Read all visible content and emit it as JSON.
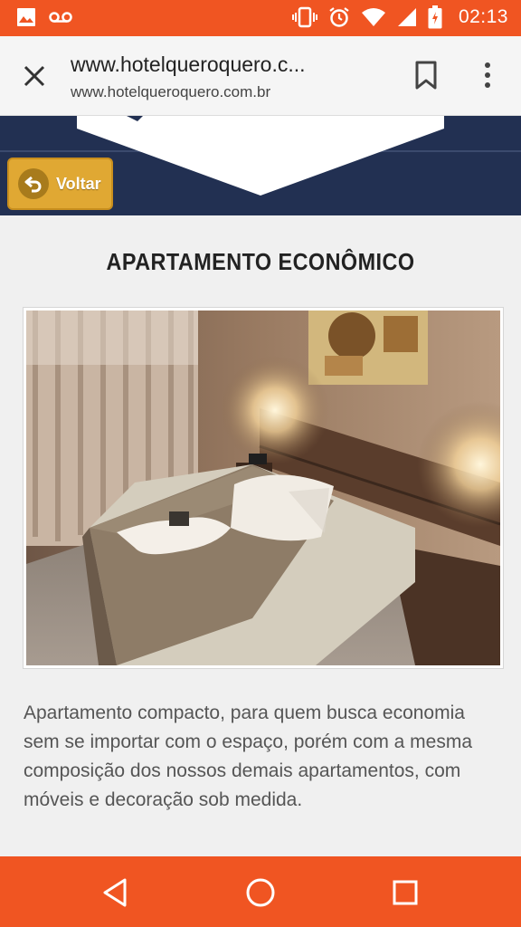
{
  "status_bar": {
    "time": "02:13",
    "left_icons": [
      "image-icon",
      "voicemail-icon"
    ],
    "right_icons": [
      "vibrate-icon",
      "alarm-icon",
      "wifi-icon",
      "signal-icon",
      "battery-icon"
    ]
  },
  "browser": {
    "page_title": "www.hotelqueroquero.c...",
    "url": "www.hotelqueroquero.com.br"
  },
  "hero": {
    "back_button_label": "Voltar"
  },
  "room": {
    "title": "APARTAMENTO ECONÔMICO",
    "description": "Apartamento compacto, para quem busca economia sem se importar com o espaço, porém com a mesma composição dos nossos demais apartamentos, com móveis e decoração sob medida."
  },
  "colors": {
    "accent": "#f05522",
    "hero_bg": "#223052",
    "back_button": "#e0a833"
  }
}
